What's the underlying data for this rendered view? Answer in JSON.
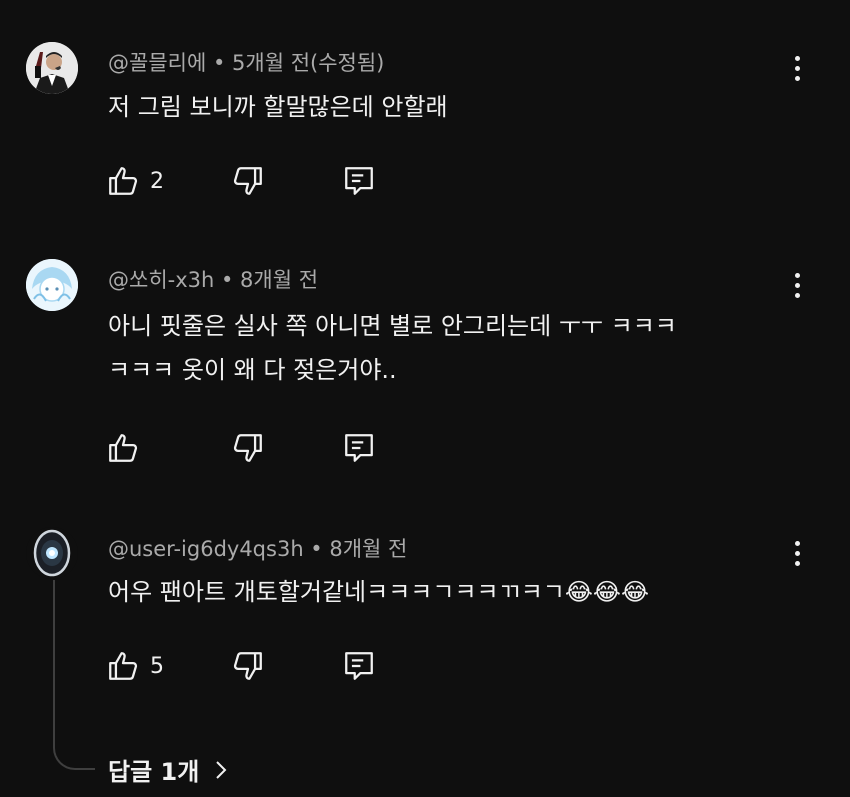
{
  "comments": [
    {
      "meta": "@꼴믈리에 • 5개월 전(수정됨)",
      "lines": [
        "저 그림 보니까 할말많은데 안할래"
      ],
      "likes": "2",
      "avatar_icon": "man-in-suit-avatar"
    },
    {
      "meta": "@쏘히-x3h • 8개월 전",
      "lines": [
        "아니 핏줄은 실사 쪽 아니면 별로 안그리는데 ㅜㅜ ㅋㅋㅋ",
        "ㅋㅋㅋ 옷이 왜 다 젖은거야.."
      ],
      "likes": "",
      "avatar_icon": "anime-character-avatar"
    },
    {
      "meta": "@user-ig6dy4qs3h • 8개월 전",
      "lines": [
        "어우 팬아트 개토할거같네ㅋㅋㅋㄱㅋㅋㄲㅋㄱ😂😂😂"
      ],
      "likes": "5",
      "avatar_icon": "glowing-orb-avatar"
    }
  ],
  "replies_label": "답글 1개",
  "colors": {
    "background": "#0f0f0f",
    "meta_text": "#aaaaaa",
    "text": "#f1f1f1"
  }
}
